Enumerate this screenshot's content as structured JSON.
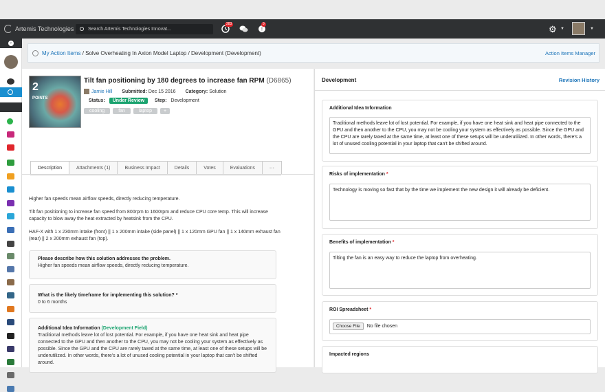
{
  "app": {
    "name": "Artemis Technologies"
  },
  "search": {
    "placeholder": "Search Artemis Technologies Innovat..."
  },
  "notifications": {
    "badge_a": "283",
    "badge_b": "9"
  },
  "breadcrumb": {
    "my_items": "My Action Items",
    "rest": " / Solve Overheating In Axion Model Laptop / Development (Development)",
    "manager": "Action Items Manager"
  },
  "idea": {
    "points": "2",
    "points_label": "POINTS",
    "title": "Tilt fan positioning by 180 degrees to increase fan RPM",
    "id": "(D6865)",
    "author": "Jamie Hill",
    "submitted_label": "Submitted:",
    "submitted": "Dec 15 2016",
    "category_label": "Category:",
    "category": "Solution",
    "status_label": "Status:",
    "status": "Under Review",
    "step_label": "Step:",
    "step": "Development",
    "tags": [
      "cooling",
      "fan",
      "laptop",
      "+"
    ]
  },
  "tabs": [
    "Description",
    "Attachments (1)",
    "Business Impact",
    "Details",
    "Votes",
    "Evaluations",
    "···"
  ],
  "description": {
    "p1": "Higher fan speeds mean airflow speeds, directly reducing temperature.",
    "p2": "Tilt fan positioning to increase fan speed from 800rpm to 1600rpm and reduce CPU core temp. This will increase capacity to blow away the heat extracted by heatsink from the CPU.",
    "p3": "HAF-X with 1 x 230mm intake (front) || 1 x 200mm intake (side panel) || 1 x 120mm GPU fan || 1 x 140mm exhaust fan (rear) || 2 x 200mm exhaust fan (top)."
  },
  "cards": [
    {
      "q": "Please describe how this solution addresses the problem.",
      "a": "Higher fan speeds mean airflow speeds, directly reducing temperature."
    },
    {
      "q": "What is the likely timeframe for implementing this solution? *",
      "a": "0 to 6 months"
    },
    {
      "q": "Additional Idea Information",
      "tag": "(Development Field)",
      "a": "Traditional methods leave lot of lost potential. For example, if you have one heat sink and heat pipe connected to the GPU and then another to the CPU, you may not be cooling your system as effectively as possible. Since the GPU and the CPU are rarely taxed at the same time, at least one of these setups will be underutilized. In other words, there's a lot of unused cooling potential in your laptop that can't be shifted around."
    }
  ],
  "right": {
    "heading": "Development",
    "revision": "Revision History",
    "sections": [
      {
        "label": "Additional Idea Information",
        "req": "",
        "value": "Traditional methods leave lot of lost potential. For example, if you have one heat sink and heat pipe connected to the GPU and then another to the CPU, you may not be cooling your system as effectively as possible. Since the GPU and the CPU are rarely taxed at the same time, at least one of these setups will be underutilized. In other words, there's a lot of unused cooling potential in your laptop that can't be shifted around."
      },
      {
        "label": "Risks of implementation",
        "req": "*",
        "value": "Technology is moving so fast that by the time we implement the new design it will already be deficient."
      },
      {
        "label": "Benefits of implementation",
        "req": "*",
        "value": "Tilting the fan is an easy way to reduce the laptop from overheating."
      },
      {
        "label": "ROI Spreadsheet",
        "req": "*",
        "button": "Choose File",
        "file": "No file chosen"
      },
      {
        "label": "Impacted regions",
        "req": ""
      }
    ]
  },
  "colors": {
    "accent": "#1a73b8",
    "success": "#1aa36f",
    "topbar": "#2f3133"
  }
}
